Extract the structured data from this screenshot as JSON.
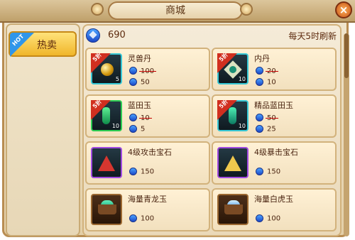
{
  "window": {
    "title": "商城",
    "close_label": "×"
  },
  "sidebar": {
    "hot_badge": "HOT",
    "hot_label": "热卖"
  },
  "header": {
    "balance": "690",
    "refresh_text": "每天5时刷新"
  },
  "items": [
    {
      "name": "灵兽丹",
      "badge": "5折",
      "qty": "5",
      "old_price": "100",
      "price": "50",
      "icon": "pearl-icon"
    },
    {
      "name": "内丹",
      "badge": "5折",
      "qty": "10",
      "old_price": "20",
      "price": "10",
      "icon": "inner-core-icon"
    },
    {
      "name": "蓝田玉",
      "badge": "5折",
      "qty": "10",
      "old_price": "10",
      "price": "5",
      "icon": "jade-icon"
    },
    {
      "name": "精品蓝田玉",
      "badge": "5折",
      "qty": "10",
      "old_price": "50",
      "price": "25",
      "icon": "premium-jade-icon"
    },
    {
      "name": "4级攻击宝石",
      "badge": "",
      "qty": "",
      "old_price": "",
      "price": "150",
      "icon": "red-gem-icon"
    },
    {
      "name": "4级暴击宝石",
      "badge": "",
      "qty": "",
      "old_price": "",
      "price": "150",
      "icon": "gold-gem-icon"
    },
    {
      "name": "海量青龙玉",
      "badge": "",
      "qty": "",
      "old_price": "",
      "price": "100",
      "icon": "green-jade-basket-icon"
    },
    {
      "name": "海量白虎玉",
      "badge": "",
      "qty": "",
      "old_price": "",
      "price": "100",
      "icon": "white-tiger-jade-icon"
    }
  ],
  "colors": {
    "accent": "#2f96ea",
    "sale": "#d12f1f",
    "text": "#4a2410"
  }
}
